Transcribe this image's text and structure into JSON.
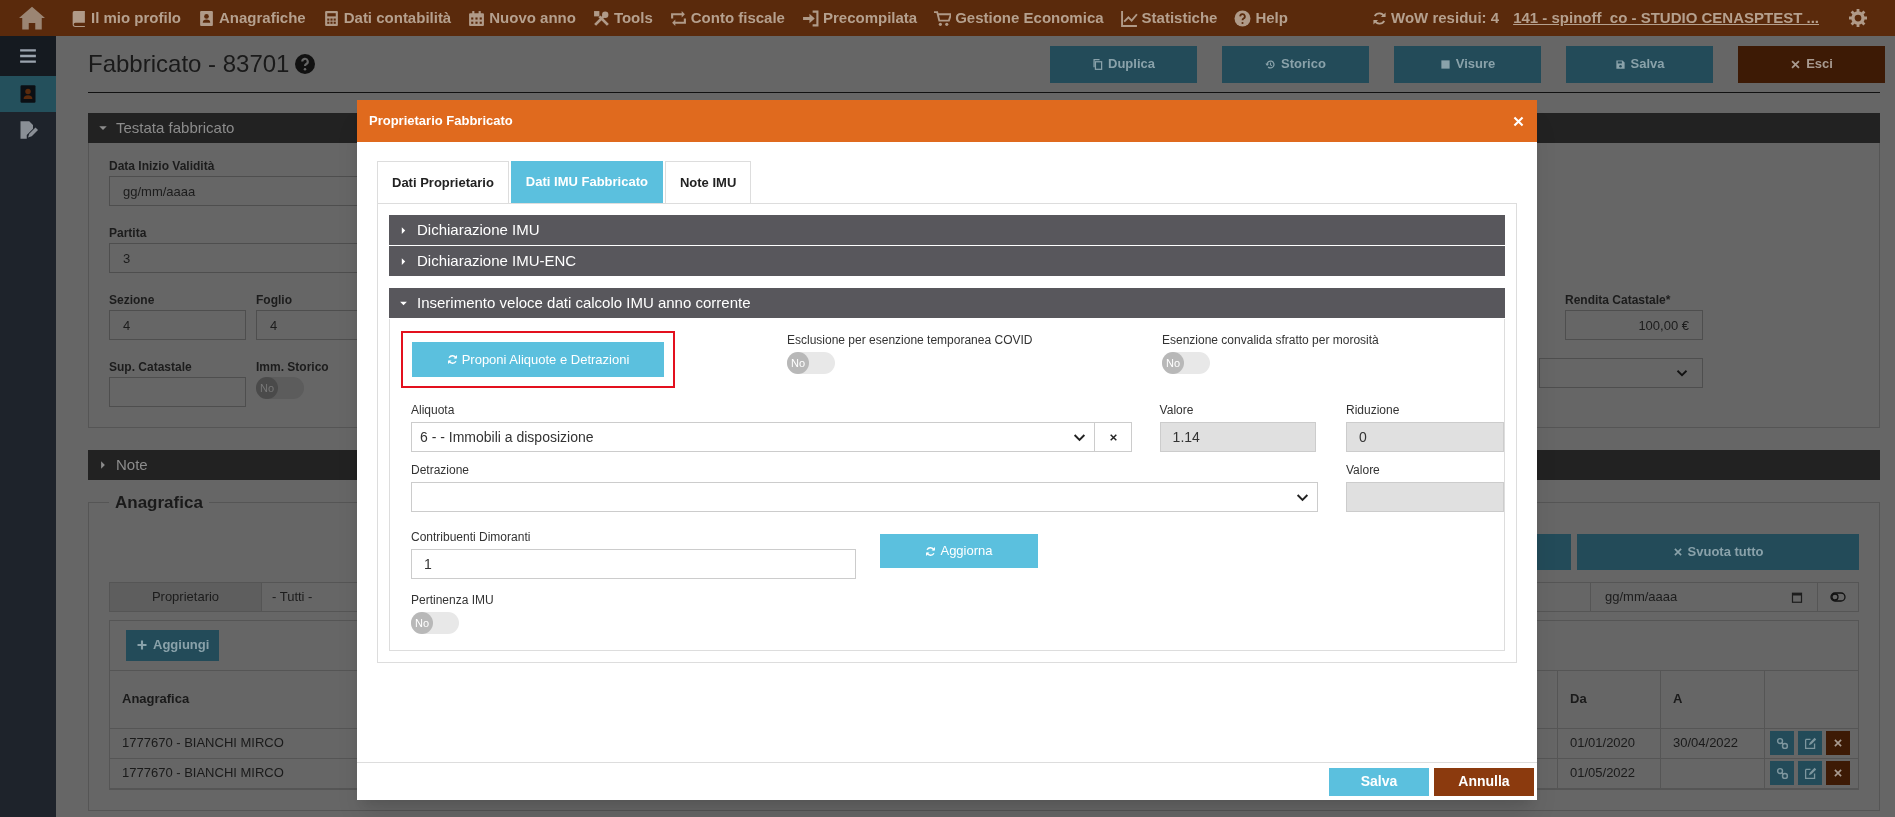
{
  "nav": {
    "items": [
      {
        "label": "Il mio profilo"
      },
      {
        "label": "Anagrafiche"
      },
      {
        "label": "Dati contabilità"
      },
      {
        "label": "Nuovo anno"
      },
      {
        "label": "Tools"
      },
      {
        "label": "Conto fiscale"
      },
      {
        "label": "Precompilata"
      },
      {
        "label": "Gestione Economica"
      },
      {
        "label": "Statistiche"
      },
      {
        "label": "Help"
      }
    ],
    "credits": "WoW residui: 4",
    "account": "141 - spinoff_co - STUDIO CENASPTEST ..."
  },
  "sidebar": {
    "items": [
      {
        "selected": true
      },
      {
        "selected": false
      }
    ]
  },
  "page": {
    "title": "Fabbricato - 83701",
    "actions": [
      {
        "label": "Duplica",
        "kind": "secondary"
      },
      {
        "label": "Storico",
        "kind": "secondary"
      },
      {
        "label": "Visure",
        "kind": "secondary"
      },
      {
        "label": "Salva",
        "kind": "secondary"
      },
      {
        "label": "Esci",
        "kind": "danger"
      }
    ]
  },
  "testata": {
    "title": "Testata fabbricato",
    "expanded": true,
    "data_inizio": {
      "label": "Data Inizio Validità",
      "placeholder": "gg/mm/aaaa"
    },
    "partita": {
      "label": "Partita",
      "value": "3"
    },
    "sezione": {
      "label": "Sezione",
      "value": "4"
    },
    "foglio": {
      "label": "Foglio",
      "value": "4"
    },
    "sup_catastale": {
      "label": "Sup. Catastale"
    },
    "imm_storico": {
      "label": "Imm. Storico",
      "text": "No",
      "on": false
    },
    "rendita": {
      "label": "Rendita Catastale*",
      "value": "100,00 €"
    }
  },
  "note_section": {
    "title": "Note",
    "expanded": false
  },
  "anagrafica": {
    "legend": "Anagrafica",
    "clear_button": "Svuota tutto",
    "filter": {
      "label": "Proprietario",
      "value": "- Tutti -",
      "date_placeholder": "gg/mm/aaaa"
    },
    "add_button": "Aggiungi",
    "columns": [
      "Anagrafica",
      "Da",
      "A"
    ],
    "rows": [
      {
        "anagrafica": "1777670 - BIANCHI MIRCO",
        "da": "01/01/2020",
        "a": "30/04/2022"
      },
      {
        "anagrafica": "1777670 - BIANCHI MIRCO",
        "da": "01/05/2022"
      }
    ]
  },
  "dialog": {
    "title": "Proprietario Fabbricato",
    "tabs": [
      {
        "label": "Dati Proprietario",
        "selected": false
      },
      {
        "label": "Dati IMU Fabbricato",
        "selected": true
      },
      {
        "label": "Note IMU",
        "selected": false
      }
    ],
    "sections": [
      {
        "title": "Dichiarazione IMU",
        "expanded": false
      },
      {
        "title": "Dichiarazione IMU-ENC",
        "expanded": false
      },
      {
        "title": "Inserimento veloce dati calcolo IMU anno corrente",
        "expanded": true
      }
    ],
    "propose_button": {
      "label": "Proponi Aliquote e Detrazioni",
      "highlighted": true
    },
    "toggles": [
      {
        "label": "Esclusione per esenzione temporanea COVID",
        "text": "No",
        "on": false
      },
      {
        "label": "Esenzione convalida sfratto per morosità",
        "text": "No",
        "on": false
      }
    ],
    "aliquota": {
      "label": "Aliquota",
      "value": "6 - - Immobili a disposizione"
    },
    "aliquota_valore": {
      "label": "Valore",
      "value": "1.14"
    },
    "riduzione": {
      "label": "Riduzione",
      "value": "0"
    },
    "detrazione": {
      "label": "Detrazione"
    },
    "detrazione_valore": {
      "label": "Valore"
    },
    "contribuenti": {
      "label": "Contribuenti Dimoranti",
      "value": "1"
    },
    "update_button": "Aggiorna",
    "pertinenza": {
      "label": "Pertinenza IMU",
      "text": "No",
      "on": false
    },
    "buttons": [
      {
        "label": "Salva",
        "kind": "primary"
      },
      {
        "label": "Annulla",
        "kind": "cancel"
      }
    ]
  }
}
